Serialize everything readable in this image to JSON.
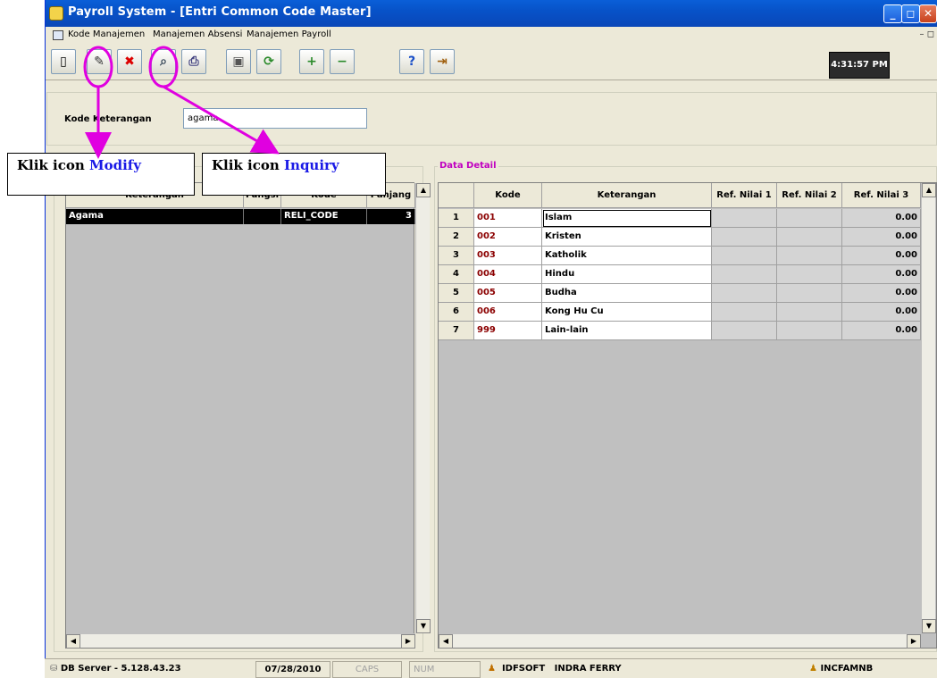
{
  "window": {
    "title": "Payroll System - [Entri Common Code Master]"
  },
  "menu": {
    "items": [
      "Kode Manajemen",
      "Manajemen Absensi",
      "Manajemen Payroll"
    ]
  },
  "toolbar": {
    "buttons": [
      "new-icon",
      "modify-icon",
      "delete-icon",
      "inquiry-icon",
      "print-icon",
      "save-icon",
      "refresh-icon",
      "add-detail-icon",
      "remove-detail-icon",
      "help-icon",
      "exit-icon"
    ],
    "clock": "4:31:57 PM"
  },
  "header": {
    "label": "Kode Keterangan",
    "value": "agama"
  },
  "left_grid": {
    "columns": [
      "Keterangan",
      "Fungsi",
      "Kode",
      "Panjang"
    ],
    "rows": [
      {
        "keterangan": "Agama",
        "fungsi": "",
        "kode": "RELI_CODE",
        "panjang": "3"
      }
    ]
  },
  "right_grid": {
    "title": "Data Detail",
    "columns": [
      "Kode",
      "Keterangan",
      "Ref. Nilai 1",
      "Ref. Nilai 2",
      "Ref. Nilai 3"
    ],
    "rows": [
      {
        "no": "1",
        "kode": "001",
        "keterangan": "Islam",
        "n1": "",
        "n2": "",
        "n3": "0.00"
      },
      {
        "no": "2",
        "kode": "002",
        "keterangan": "Kristen",
        "n1": "",
        "n2": "",
        "n3": "0.00"
      },
      {
        "no": "3",
        "kode": "003",
        "keterangan": "Katholik",
        "n1": "",
        "n2": "",
        "n3": "0.00"
      },
      {
        "no": "4",
        "kode": "004",
        "keterangan": "Hindu",
        "n1": "",
        "n2": "",
        "n3": "0.00"
      },
      {
        "no": "5",
        "kode": "005",
        "keterangan": "Budha",
        "n1": "",
        "n2": "",
        "n3": "0.00"
      },
      {
        "no": "6",
        "kode": "006",
        "keterangan": "Kong Hu Cu",
        "n1": "",
        "n2": "",
        "n3": "0.00"
      },
      {
        "no": "7",
        "kode": "999",
        "keterangan": "Lain-lain",
        "n1": "",
        "n2": "",
        "n3": "0.00"
      }
    ]
  },
  "statusbar": {
    "db": "DB Server - 5.128.43.23",
    "date": "07/28/2010",
    "caps": "CAPS",
    "num": "NUM",
    "company": "IDFSOFT",
    "user": "INDRA FERRY",
    "host": "INCFAMNB"
  },
  "callouts": {
    "modify_prefix": "Klik icon ",
    "modify_word": "Modify",
    "inquiry_prefix": "Klik icon ",
    "inquiry_word": "Inquiry"
  },
  "colors": {
    "annotation": "#e000e0",
    "titlebar": "#0a5fd8",
    "kode_text": "#8b0000"
  }
}
